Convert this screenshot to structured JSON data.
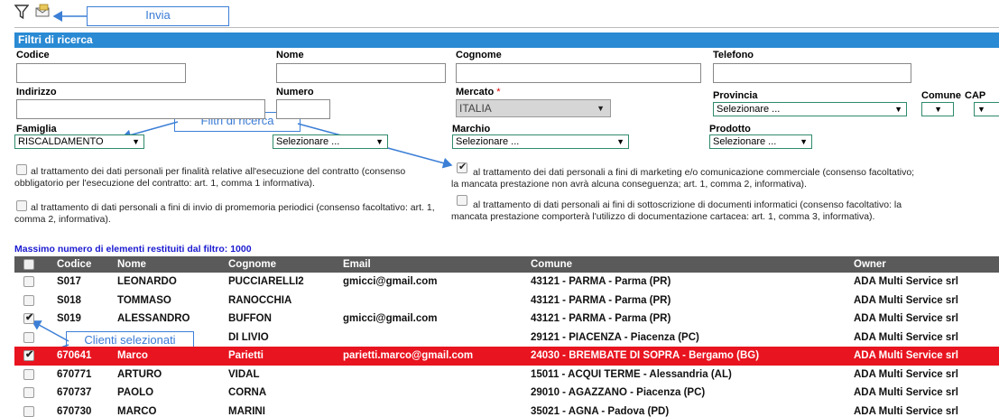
{
  "toolbar": {
    "filter_icon": "funnel-icon",
    "send_icon": "envelope-send-icon"
  },
  "callouts": {
    "send": "Invia",
    "filters": "Filtri di ricerca",
    "selected": "Clienti selezionati"
  },
  "panel": {
    "title": "Filtri di ricerca"
  },
  "form": {
    "codice_label": "Codice",
    "nome_label": "Nome",
    "cognome_label": "Cognome",
    "telefono_label": "Telefono",
    "indirizzo_label": "Indirizzo",
    "numero_label": "Numero",
    "mercato_label": "Mercato",
    "mercato_required": "*",
    "mercato_value": "ITALIA",
    "provincia_label": "Provincia",
    "provincia_value": "Selezionare ...",
    "comune_label": "Comune",
    "cap_label": "CAP",
    "famiglia_label": "Famiglia",
    "famiglia_value": "RISCALDAMENTO",
    "tipologia_value": "Selezionare ...",
    "marchio_label": "Marchio",
    "marchio_value": "Selezionare ...",
    "prodotto_label": "Prodotto",
    "prodotto_value": "Selezionare ..."
  },
  "consents": [
    {
      "text": "al trattamento dei dati personali per finalità relative all'esecuzione del contratto (consenso obbligatorio per l'esecuzione del contratto: art. 1, comma 1 informativa).",
      "checked": false
    },
    {
      "text": "al trattamento dei dati personali a fini di marketing e/o comunicazione commerciale (consenso facoltativo; la mancata prestazione non avrà alcuna conseguenza; art. 1, comma 2, informativa).",
      "checked": true
    },
    {
      "text": "al trattamento di dati personali a fini di invio di promemoria periodici (consenso facoltativo: art. 1, comma 2, informativa).",
      "checked": false
    },
    {
      "text": "al trattamento di dati personali ai fini di sottoscrizione di documenti informatici (consenso facoltativo: la mancata prestazione comporterà l'utilizzo di documentazione cartacea: art. 1, comma 3, informativa).",
      "checked": false
    }
  ],
  "max_note": "Massimo numero di elementi restituiti dal filtro: 1000",
  "grid": {
    "columns": [
      "Codice",
      "Nome",
      "Cognome",
      "Email",
      "Comune",
      "Owner"
    ],
    "rows": [
      {
        "codice": "S017",
        "nome": "LEONARDO",
        "cognome": "PUCCIARELLI2",
        "email": "gmicci@gmail.com",
        "comune": "43121 - PARMA - Parma (PR)",
        "owner": "ADA Multi Service srl",
        "checked": false,
        "selected": false
      },
      {
        "codice": "S018",
        "nome": "TOMMASO",
        "cognome": "RANOCCHIA",
        "email": "",
        "comune": "43121 - PARMA - Parma (PR)",
        "owner": "ADA Multi Service srl",
        "checked": false,
        "selected": false
      },
      {
        "codice": "S019",
        "nome": "ALESSANDRO",
        "cognome": "BUFFON",
        "email": "gmicci@gmail.com",
        "comune": "43121 - PARMA - Parma (PR)",
        "owner": "ADA Multi Service srl",
        "checked": true,
        "selected": false
      },
      {
        "codice": "",
        "nome": "",
        "cognome": "DI LIVIO",
        "email": "",
        "comune": "29121 - PIACENZA - Piacenza (PC)",
        "owner": "ADA Multi Service srl",
        "checked": false,
        "selected": false
      },
      {
        "codice": "670641",
        "nome": "Marco",
        "cognome": "Parietti",
        "email": "parietti.marco@gmail.com",
        "comune": "24030 - BREMBATE DI SOPRA - Bergamo (BG)",
        "owner": "ADA Multi Service srl",
        "checked": true,
        "selected": true
      },
      {
        "codice": "670771",
        "nome": "ARTURO",
        "cognome": "VIDAL",
        "email": "",
        "comune": "15011 - ACQUI TERME - Alessandria (AL)",
        "owner": "ADA Multi Service srl",
        "checked": false,
        "selected": false
      },
      {
        "codice": "670737",
        "nome": "PAOLO",
        "cognome": "CORNA",
        "email": "",
        "comune": "29010 - AGAZZANO - Piacenza (PC)",
        "owner": "ADA Multi Service srl",
        "checked": false,
        "selected": false
      },
      {
        "codice": "670730",
        "nome": "MARCO",
        "cognome": "MARINI",
        "email": "",
        "comune": "35021 - AGNA - Padova (PD)",
        "owner": "ADA Multi Service srl",
        "checked": false,
        "selected": false
      }
    ]
  }
}
